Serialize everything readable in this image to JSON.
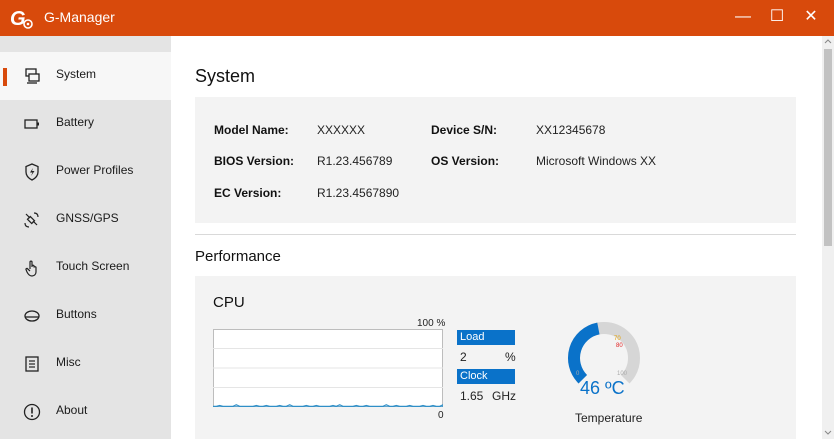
{
  "app": {
    "title": "G-Manager"
  },
  "window_controls": {
    "minimize": "—",
    "maximize": "☐",
    "close": "✕"
  },
  "sidebar": {
    "items": [
      {
        "label": "System",
        "icon": "system-icon",
        "active": true
      },
      {
        "label": "Battery",
        "icon": "battery-icon",
        "active": false
      },
      {
        "label": "Power Profiles",
        "icon": "power-profile-shield-icon",
        "active": false
      },
      {
        "label": "GNSS/GPS",
        "icon": "satellite-icon",
        "active": false
      },
      {
        "label": "Touch Screen",
        "icon": "touch-hand-icon",
        "active": false
      },
      {
        "label": "Buttons",
        "icon": "button-icon",
        "active": false
      },
      {
        "label": "Misc",
        "icon": "list-icon",
        "active": false
      },
      {
        "label": "About",
        "icon": "info-icon",
        "active": false
      }
    ]
  },
  "page": {
    "title": "System"
  },
  "system_info": {
    "model_name_label": "Model Name:",
    "model_name": "XXXXXX",
    "device_sn_label": "Device S/N:",
    "device_sn": "XX12345678",
    "bios_label": "BIOS Version:",
    "bios": "R1.23.456789",
    "os_label": "OS Version:",
    "os": "Microsoft Windows XX",
    "ec_label": "EC Version:",
    "ec": "R1.23.4567890"
  },
  "performance": {
    "title": "Performance",
    "cpu": {
      "title": "CPU",
      "graph_max_label": "100 %",
      "graph_min_label": "0",
      "load_label": "Load",
      "load_value": "2",
      "load_unit": "%",
      "clock_label": "Clock",
      "clock_value": "1.65",
      "clock_unit": "GHz",
      "load_history": [
        1,
        1,
        2,
        1,
        1,
        1,
        1,
        3,
        1,
        1,
        1,
        1,
        1,
        2,
        1,
        1,
        2,
        1,
        1,
        1,
        2,
        1,
        1,
        3,
        1,
        1,
        1,
        1,
        2,
        1,
        1,
        2,
        1,
        1,
        1,
        1,
        2,
        1,
        3,
        1,
        1,
        1,
        1,
        2,
        1,
        1,
        2,
        1,
        1,
        1,
        1,
        1,
        3,
        1,
        1,
        2,
        1,
        1,
        1,
        2,
        1,
        1,
        1,
        2,
        1,
        1,
        2,
        1,
        1,
        3
      ],
      "temperature": {
        "value": "46 ºC",
        "label": "Temperature",
        "level_percent": 46,
        "tick_70": "70",
        "tick_80": "80",
        "tick_0": "0",
        "tick_100": "100",
        "arc_color": "#0a72c9",
        "track_color": "#d6d6d6"
      }
    }
  },
  "colors": {
    "accent": "#d84a0c",
    "selection_blue": "#0a72c9"
  }
}
